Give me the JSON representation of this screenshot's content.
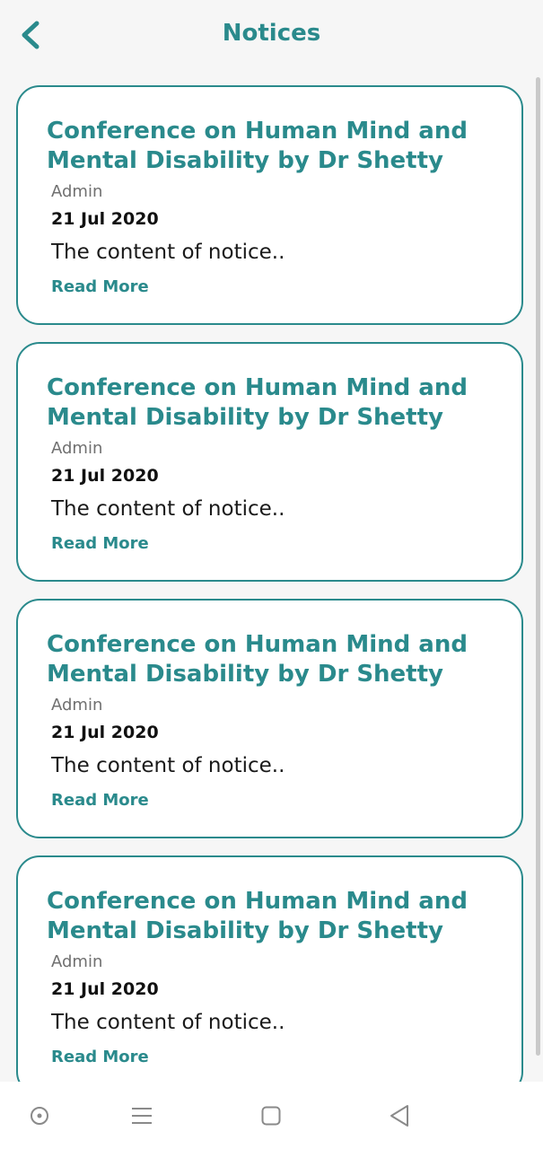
{
  "header": {
    "title": "Notices",
    "back_icon": "chevron-left-icon"
  },
  "notices": [
    {
      "title": "Conference on Human Mind and Mental Disability by Dr Shetty",
      "author": "Admin",
      "date": "21 Jul 2020",
      "content": "The content of notice..",
      "read_more": "Read More"
    },
    {
      "title": "Conference on Human Mind and Mental Disability by Dr Shetty",
      "author": "Admin",
      "date": "21 Jul 2020",
      "content": "The content of notice..",
      "read_more": "Read More"
    },
    {
      "title": "Conference on Human Mind and Mental Disability by Dr Shetty",
      "author": "Admin",
      "date": "21 Jul 2020",
      "content": "The content of notice..",
      "read_more": "Read More"
    },
    {
      "title": "Conference on Human Mind and Mental Disability by Dr Shetty",
      "author": "Admin",
      "date": "21 Jul 2020",
      "content": "The content of notice..",
      "read_more": "Read More"
    }
  ],
  "colors": {
    "accent": "#2a8a8c",
    "background": "#f6f6f6",
    "card": "#ffffff"
  },
  "navbar": {
    "icons": [
      "circle-dot-icon",
      "menu-icon",
      "square-icon",
      "triangle-back-icon"
    ]
  }
}
